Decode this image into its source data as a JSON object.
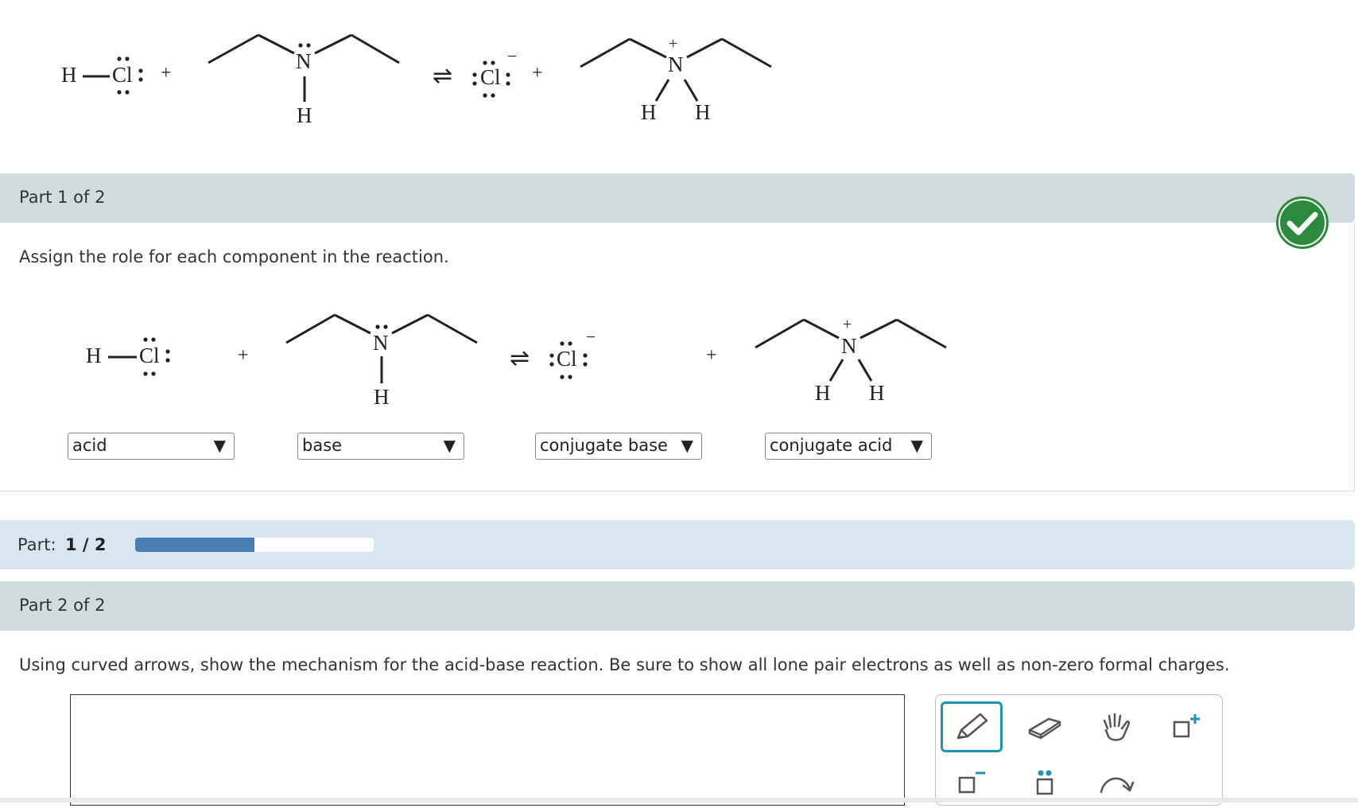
{
  "header_reaction": {
    "h": "H",
    "cl": "Cl",
    "n": "N",
    "plus": "+",
    "equilibrium": "⇌",
    "minus": "−"
  },
  "part1": {
    "label": "Part 1 of 2",
    "status": "correct",
    "prompt": "Assign the role for each component in the reaction.",
    "dropdowns": [
      {
        "value": "acid"
      },
      {
        "value": "base"
      },
      {
        "value": "conjugate base"
      },
      {
        "value": "conjugate acid"
      }
    ],
    "dropdown_arrow": "▼"
  },
  "progress": {
    "label": "Part:",
    "value_text": "1 / 2",
    "fraction": 0.5
  },
  "part2": {
    "label": "Part 2 of 2",
    "prompt": "Using curved arrows, show the mechanism for the acid-base reaction. Be sure to show all lone pair electrons as well as non-zero formal charges."
  },
  "toolbar": {
    "tools": [
      "pencil-icon",
      "eraser-icon",
      "hand-icon",
      "positive-charge-icon",
      "negative-charge-icon",
      "lone-pair-icon",
      "curved-arrow-icon"
    ],
    "selected": "pencil-icon"
  },
  "colors": {
    "gray_bar": "#d1dcdf",
    "blue_bar": "#d9e6f0",
    "progress_fill": "#4a7fb5",
    "check_green": "#2b8a3e",
    "tool_selected": "#1d94b5"
  }
}
